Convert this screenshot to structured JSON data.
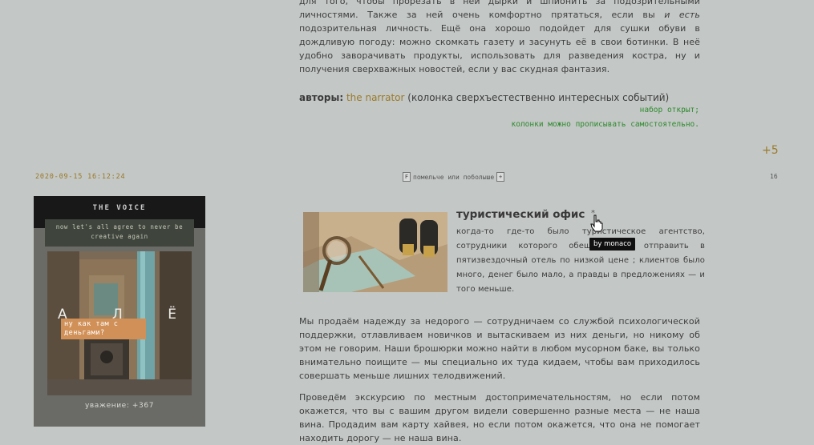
{
  "top_section": {
    "paragraph_before_em": "для того, чтобы прорезать в ней дырки и шпионить за подозрительными личностями. Также за ней очень комфортно прятаться, если вы",
    "paragraph_em": "и есть",
    "paragraph_after_em": "подозрительная личность. Ещё она хорошо подойдет для сушки обуви в дождливую погоду: можно скомкать газету и засунуть её в свои ботинки. В неё удобно заворачивать продукты, использовать для разведения костра, ну и получения сверхважных новостей, если у вас скудная фантазия.",
    "authors_label": "авторы:",
    "authors_link": "the narrator",
    "authors_rest": "(колонка сверхъестественно интересных событий)",
    "status_open": "набор открыт;",
    "status_columns": "колонки можно прописывать самостоятельно.",
    "rating": "+5"
  },
  "post_meta": {
    "date": "2020-09-15 16:12:24",
    "vote_minus": "F",
    "vote_text": "помельче или поболыше",
    "vote_plus": "+",
    "number": "16"
  },
  "profile": {
    "title": "THE VOICE",
    "quote": "now let's all agree to never be creative again",
    "big_letters": [
      "А",
      "Л",
      "Ё"
    ],
    "caption": "ну как там с деньгами?",
    "respect": "уважение: +367"
  },
  "post": {
    "title": "туристический офис",
    "star": "*",
    "tooltip": "by monaco",
    "description": "когда-то где-то было туристическое агентство, сотрудники которого обещали вас отправить в пятизвездочный отель по низкой цене ; клиентов было много, денег было мало, а правды в предложениях — и того меньше.",
    "paragraph1": "Мы продаём надежду за недорого — сотрудничаем со службой психологической поддержки, отлавливаем новичков и вытаскиваем из них деньги, но никому об этом не говорим. Наши брошюрки можно найти в любом мусорном баке, вы только внимательно поищите — мы специально их туда кидаем, чтобы вам приходилось совершать меньше лишних телодвижений.",
    "paragraph2": "Проведём экскурсию по местным достопримечательностям, но если потом окажется, что вы с вашим другом видели совершенно разные места — не наша вина. Продадим вам карту хайвея, но если потом окажется, что она не помогает находить дорогу — не наша вина."
  },
  "colors": {
    "background": "#c3c7c5",
    "accent_gold": "#9a7a2a",
    "status_green": "#2f8a2f",
    "text": "#3d3d3d"
  },
  "icons": [
    "pointer-cursor-icon"
  ]
}
